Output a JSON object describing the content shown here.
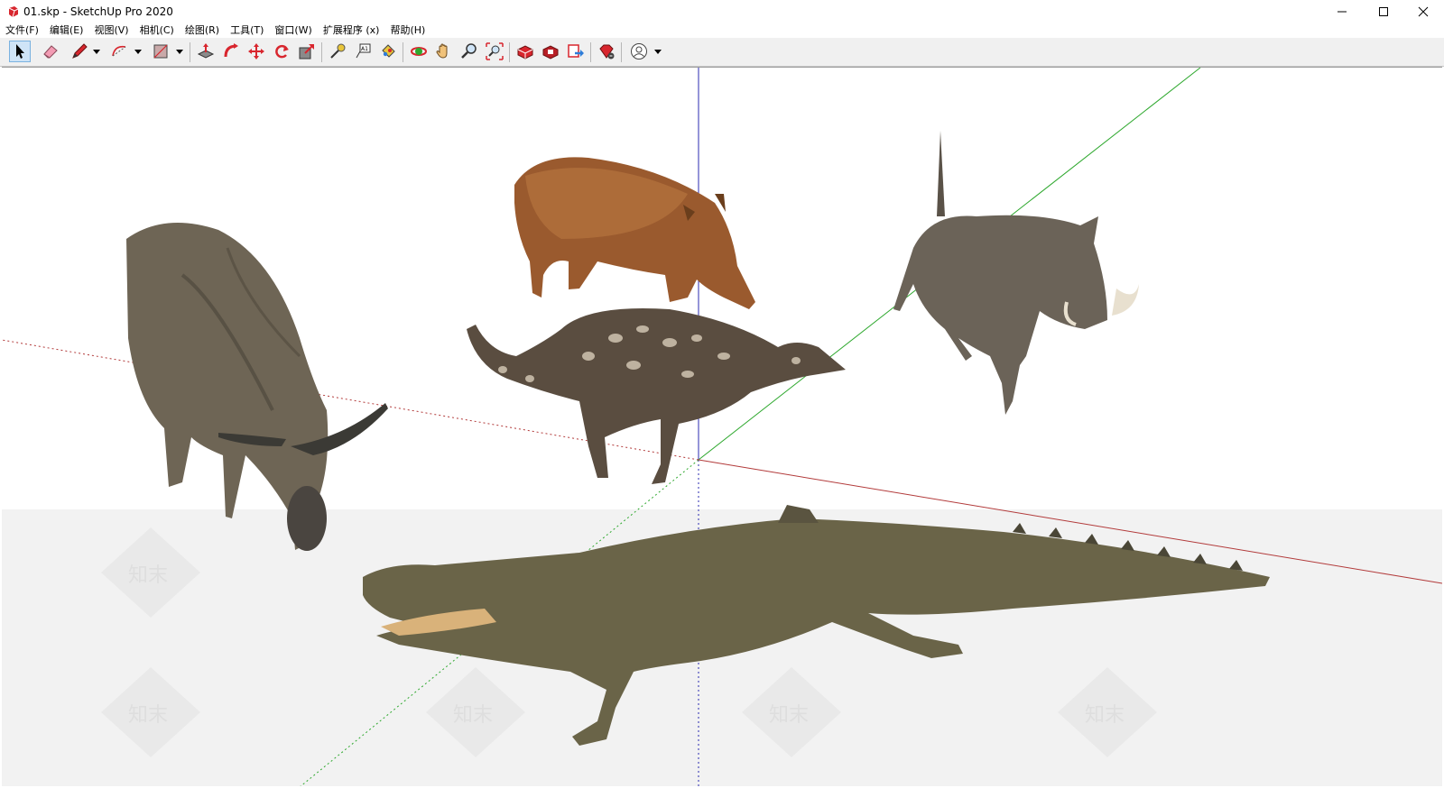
{
  "window": {
    "title": "01.skp - SketchUp Pro 2020"
  },
  "menu": {
    "items": [
      {
        "label": "文件(F)",
        "id": "file"
      },
      {
        "label": "编辑(E)",
        "id": "edit"
      },
      {
        "label": "视图(V)",
        "id": "view"
      },
      {
        "label": "相机(C)",
        "id": "camera"
      },
      {
        "label": "绘图(R)",
        "id": "draw"
      },
      {
        "label": "工具(T)",
        "id": "tools"
      },
      {
        "label": "窗口(W)",
        "id": "window"
      },
      {
        "label": "扩展程序 (x)",
        "id": "extensions"
      },
      {
        "label": "帮助(H)",
        "id": "help"
      }
    ]
  },
  "toolbar": {
    "active_tool": "select",
    "tools": [
      "select",
      "eraser",
      "pencil",
      "arc",
      "shape",
      "push-pull",
      "follow-me",
      "move",
      "rotate",
      "scale",
      "tape-measure",
      "text",
      "paint-bucket",
      "orbit",
      "pan",
      "zoom",
      "zoom-extents",
      "3d-warehouse",
      "extension-warehouse",
      "send-to-layout",
      "extension-manager",
      "account"
    ]
  },
  "watermark": {
    "text": "知末"
  },
  "colors": {
    "axis_red": "#b23a3a",
    "axis_green": "#2ea82e",
    "axis_blue": "#2b2bb0",
    "ground": "#f2f2f2",
    "toolbar_bg": "#f0f0f0",
    "active_tool": "#cfe4f7"
  }
}
